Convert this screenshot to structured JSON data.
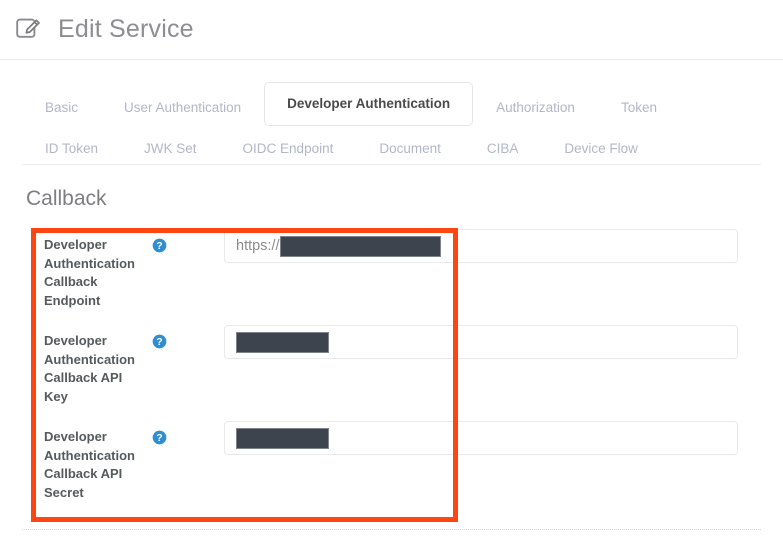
{
  "header": {
    "title": "Edit Service",
    "icon": "edit-pencil-icon"
  },
  "tabs": {
    "row1": [
      {
        "label": "Basic",
        "active": false
      },
      {
        "label": "User Authentication",
        "active": false
      },
      {
        "label": "Developer Authentication",
        "active": true
      },
      {
        "label": "Authorization",
        "active": false
      },
      {
        "label": "Token",
        "active": false
      }
    ],
    "row2": [
      {
        "label": "ID Token",
        "active": false
      },
      {
        "label": "JWK Set",
        "active": false
      },
      {
        "label": "OIDC Endpoint",
        "active": false
      },
      {
        "label": "Document",
        "active": false
      },
      {
        "label": "CIBA",
        "active": false
      },
      {
        "label": "Device Flow",
        "active": false
      }
    ]
  },
  "section": {
    "title": "Callback"
  },
  "fields": [
    {
      "label": "Developer Authentication Callback Endpoint",
      "help_icon": "help-circle-icon",
      "prefix": "https://",
      "value": "",
      "redacted": true,
      "redaction_width": "wide"
    },
    {
      "label": "Developer Authentication Callback API Key",
      "help_icon": "help-circle-icon",
      "prefix": "",
      "value": "",
      "redacted": true,
      "redaction_width": "narrow"
    },
    {
      "label": "Developer Authentication Callback API Secret",
      "help_icon": "help-circle-icon",
      "prefix": "",
      "value": "",
      "redacted": true,
      "redaction_width": "narrow"
    }
  ],
  "colors": {
    "highlight": "#ff4612",
    "help_icon": "#2e8fd0",
    "redaction": "#3e444d",
    "active_tab_text": "#4a4a4a",
    "inactive_tab_text": "#b2b6c9"
  }
}
